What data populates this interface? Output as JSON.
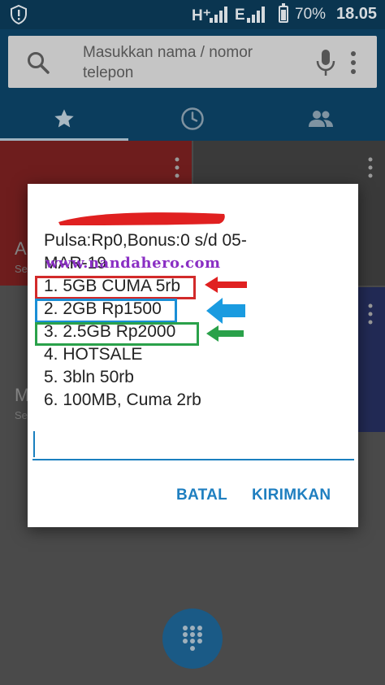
{
  "status_bar": {
    "network_h": "H⁺",
    "network_e": "E",
    "battery_percent": "70%",
    "time": "18.05",
    "icons": [
      "shield-icon",
      "signal-icon",
      "battery-icon"
    ]
  },
  "search": {
    "placeholder": "Masukkan nama / nomor telepon",
    "icons": [
      "search-icon",
      "mic-icon",
      "more-vert-icon"
    ]
  },
  "tabs": [
    {
      "icon": "star-icon",
      "active": true
    },
    {
      "icon": "clock-icon",
      "active": false
    },
    {
      "icon": "contacts-icon",
      "active": false
    }
  ],
  "contacts_tiles": [
    {
      "letter": "A",
      "sub": "Se",
      "color": "#6e1d1d"
    },
    {
      "letter": "",
      "sub": "",
      "color": "#3a3a3a"
    },
    {
      "letter": "M",
      "sub": "Se",
      "color": "#4a4a4a"
    },
    {
      "letter": "",
      "sub": "",
      "color": "#222a55"
    }
  ],
  "dialog": {
    "lines": [
      "Pulsa:Rp0,Bonus:0 s/d 05-",
      "MAR-19",
      "1. 5GB CUMA 5rb",
      "2. 2GB Rp1500",
      "3. 2.5GB Rp2000",
      "4. HOTSALE",
      "5. 3bln 50rb",
      "6. 100MB, Cuma 2rb"
    ],
    "watermark": "www.nandahero.com",
    "reply_value": "",
    "cancel_label": "BATAL",
    "send_label": "KIRIMKAN",
    "highlight_colors": [
      "#d22a2a",
      "#1a8fd6",
      "#2aa14a"
    ]
  },
  "fab": {
    "icon": "dialpad-icon"
  }
}
